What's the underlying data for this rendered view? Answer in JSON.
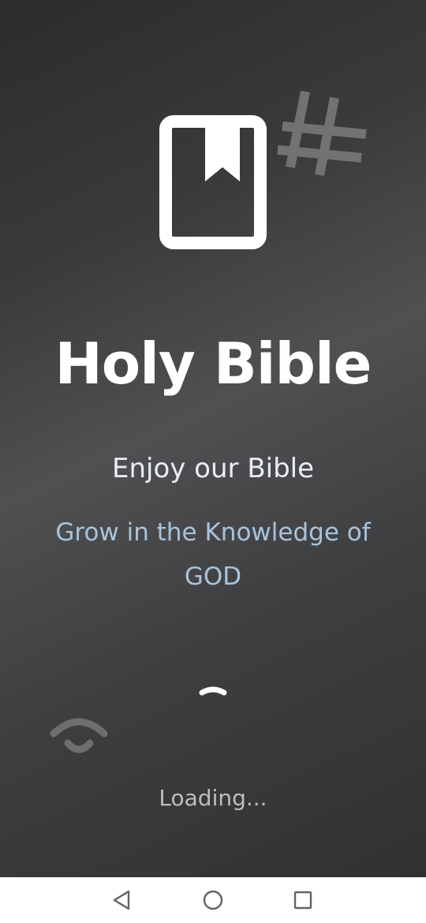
{
  "splash": {
    "title": "Holy Bible",
    "subtitle": "Enjoy our Bible",
    "tagline": "Grow in the Knowledge of GOD",
    "loading_text": "Loading...",
    "icons": {
      "app_logo": "book-bookmark-icon",
      "decoration": "hash-icon",
      "progress": "loading-spinner-icon"
    },
    "colors": {
      "title": "#ffffff",
      "subtitle": "#e8eef4",
      "tagline": "#a8c4dc",
      "loading": "#bdbdbd",
      "background": "#3a3a3c"
    }
  },
  "navigation_bar": {
    "buttons": [
      "back-icon",
      "home-icon",
      "recent-apps-icon"
    ]
  }
}
